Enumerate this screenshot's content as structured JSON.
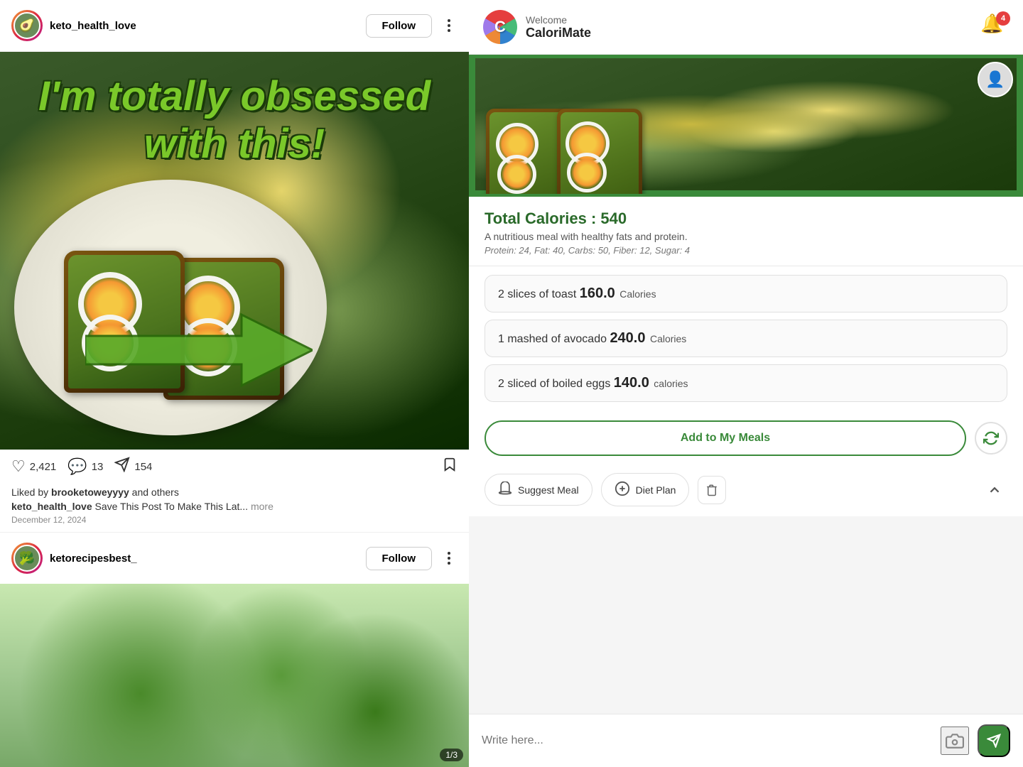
{
  "background": {
    "color": "#6b8f5e"
  },
  "left_panel": {
    "post1": {
      "username": "keto_health_love",
      "follow_btn": "Follow",
      "overlay_text_line1": "I'm totally obsessed",
      "overlay_text_line2": "with this!",
      "likes": "2,421",
      "comments": "13",
      "shares": "154",
      "liked_by_label": "Liked by",
      "liked_by_user": "brooketoweyyyy",
      "liked_by_suffix": "and others",
      "caption_user": "keto_health_love",
      "caption_text": "Save This Post To Make This Lat...",
      "more_label": "more",
      "post_date": "December 12, 2024"
    },
    "post2": {
      "username": "ketorecipesbest_",
      "follow_btn": "Follow",
      "page_indicator": "1/3"
    }
  },
  "right_panel": {
    "header": {
      "welcome_text": "Welcome",
      "app_name": "CaloriMate",
      "app_logo_letter": "C",
      "notification_count": "4"
    },
    "food_items": [
      {
        "quantity": "2 slices of toast",
        "calories_value": "160.0",
        "calories_label": "Calories"
      },
      {
        "quantity": "1 mashed of avocado",
        "calories_value": "240.0",
        "calories_label": "Calories"
      },
      {
        "quantity": "2 sliced of boiled eggs",
        "calories_value": "140.0",
        "calories_label": "calories"
      }
    ],
    "nutrition": {
      "total_calories_label": "Total Calories : 540",
      "description": "A nutritious meal with healthy fats and protein.",
      "macros": "Protein: 24, Fat: 40, Carbs: 50, Fiber: 12, Sugar: 4"
    },
    "buttons": {
      "add_to_meals": "Add to My Meals",
      "suggest_meal": "Suggest Meal",
      "diet_plan": "Diet Plan"
    },
    "chat": {
      "placeholder": "Write here..."
    }
  }
}
